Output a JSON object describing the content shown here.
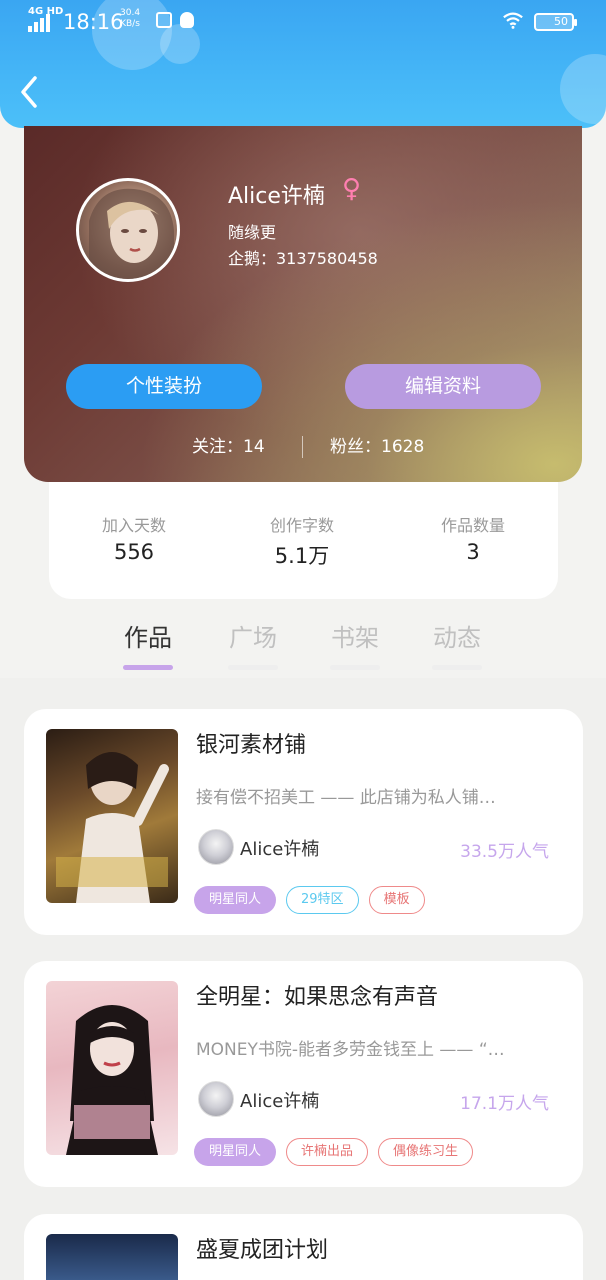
{
  "status_bar": {
    "network": "4G HD",
    "time": "18:16",
    "speed_value": "30.4",
    "speed_unit": "KB/s",
    "battery": "50"
  },
  "profile": {
    "username": "Alice许楠",
    "gender_symbol": "♀",
    "tagline": "随缘更",
    "qq_label": "企鹅：3137580458",
    "button_dress": "个性装扮",
    "button_edit": "编辑资料",
    "follow_label": "关注：14",
    "fans_label": "粉丝：1628"
  },
  "stats": [
    {
      "label": "加入天数",
      "value": "556"
    },
    {
      "label": "创作字数",
      "value": "5.1万"
    },
    {
      "label": "作品数量",
      "value": "3"
    }
  ],
  "tabs": [
    {
      "label": "作品",
      "active": true
    },
    {
      "label": "广场",
      "active": false
    },
    {
      "label": "书架",
      "active": false
    },
    {
      "label": "动态",
      "active": false
    }
  ],
  "works": [
    {
      "title": "银河素材铺",
      "desc": "接有偿不招美工 —— 此店铺为私人铺…",
      "author": "Alice许楠",
      "popularity": "33.5万人气",
      "tags": [
        {
          "label": "明星同人",
          "style": "fill"
        },
        {
          "label": "29特区",
          "style": "cyan"
        },
        {
          "label": "模板",
          "style": "red"
        }
      ]
    },
    {
      "title": "全明星：如果思念有声音",
      "desc": "MONEY书院-能者多劳金钱至上 —— “…",
      "author": "Alice许楠",
      "popularity": "17.1万人气",
      "tags": [
        {
          "label": "明星同人",
          "style": "fill"
        },
        {
          "label": "许楠出品",
          "style": "red"
        },
        {
          "label": "偶像练习生",
          "style": "red"
        }
      ]
    },
    {
      "title": "盛夏成团计划"
    }
  ],
  "colors": {
    "header_blue": "#3aa6f2",
    "accent_purple": "#c7a4ea",
    "button_blue": "#2b9df3",
    "button_purple": "#b89be0"
  }
}
